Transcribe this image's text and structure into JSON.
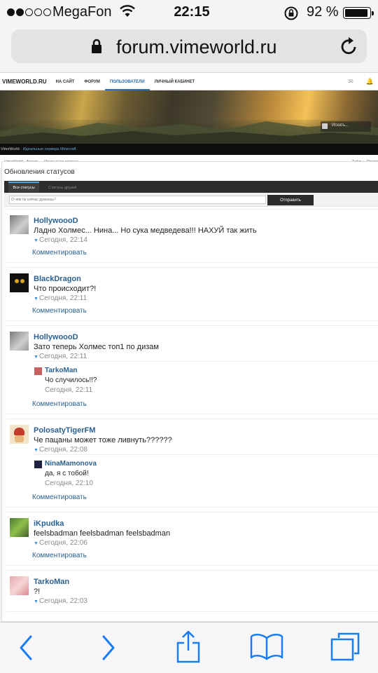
{
  "status_bar": {
    "carrier": "MegaFon",
    "time": "22:15",
    "battery": "92 %"
  },
  "browser": {
    "url": "forum.vimeworld.ru"
  },
  "nav": {
    "logo": "VIMEWORLD.RU",
    "items": [
      "НА САЙТ",
      "ФОРУМ",
      "ПОЛЬЗОВАТЕЛИ",
      "ЛИЧНЫЙ КАБИНЕТ"
    ],
    "active": "ПОЛЬЗОВАТЕЛИ"
  },
  "banner": {
    "search_placeholder": "Искать...",
    "subtitle_site": "VimeWorld",
    "subtitle_tag": "· Идеальные сервера Minecraft"
  },
  "breadcrumbs": {
    "path": "VimeWorld · Форум   →   Изменения статуса",
    "right": "Тайды · Прави"
  },
  "page": {
    "title": "Обновления статусов",
    "tab_active": "Все статусы",
    "tab_other": "Статусы друзей",
    "compose_placeholder": "О чем ты сейчас думаешь?",
    "compose_button": "Отправить"
  },
  "comment_label": "Комментировать",
  "posts": [
    {
      "author": "HollywoooD",
      "text": "Ладно Холмес... Нина... Но сука медведева!!! НАХУЙ так жить",
      "time": "Сегодня, 22:14"
    },
    {
      "author": "BlackDragon",
      "text": "Что происходит?!",
      "time": "Сегодня, 22:11"
    },
    {
      "author": "HollywoooD",
      "text": "Зато теперь Холмес топ1 по дизам",
      "time": "Сегодня, 22:11",
      "reply": {
        "author": "TarkoMan",
        "text": "Чо случилось!!?",
        "time": "Сегодня, 22:11"
      }
    },
    {
      "author": "PolosatyTigerFM",
      "text": "Че пацаны может тоже ливнуть??????",
      "time": "Сегодня, 22:08",
      "reply": {
        "author": "NinaMamonova",
        "text": "да, я с тобой!",
        "time": "Сегодня, 22:10"
      }
    },
    {
      "author": "iKpudka",
      "text": "feelsbadman feelsbadman feelsbadman",
      "time": "Сегодня, 22:06"
    },
    {
      "author": "TarkoMan",
      "text": "?!",
      "time": "Сегодня, 22:03"
    }
  ],
  "colors": {
    "link": "#2a5f8f",
    "accent": "#2a6fb0",
    "ios_blue": "#1a7cf5"
  }
}
